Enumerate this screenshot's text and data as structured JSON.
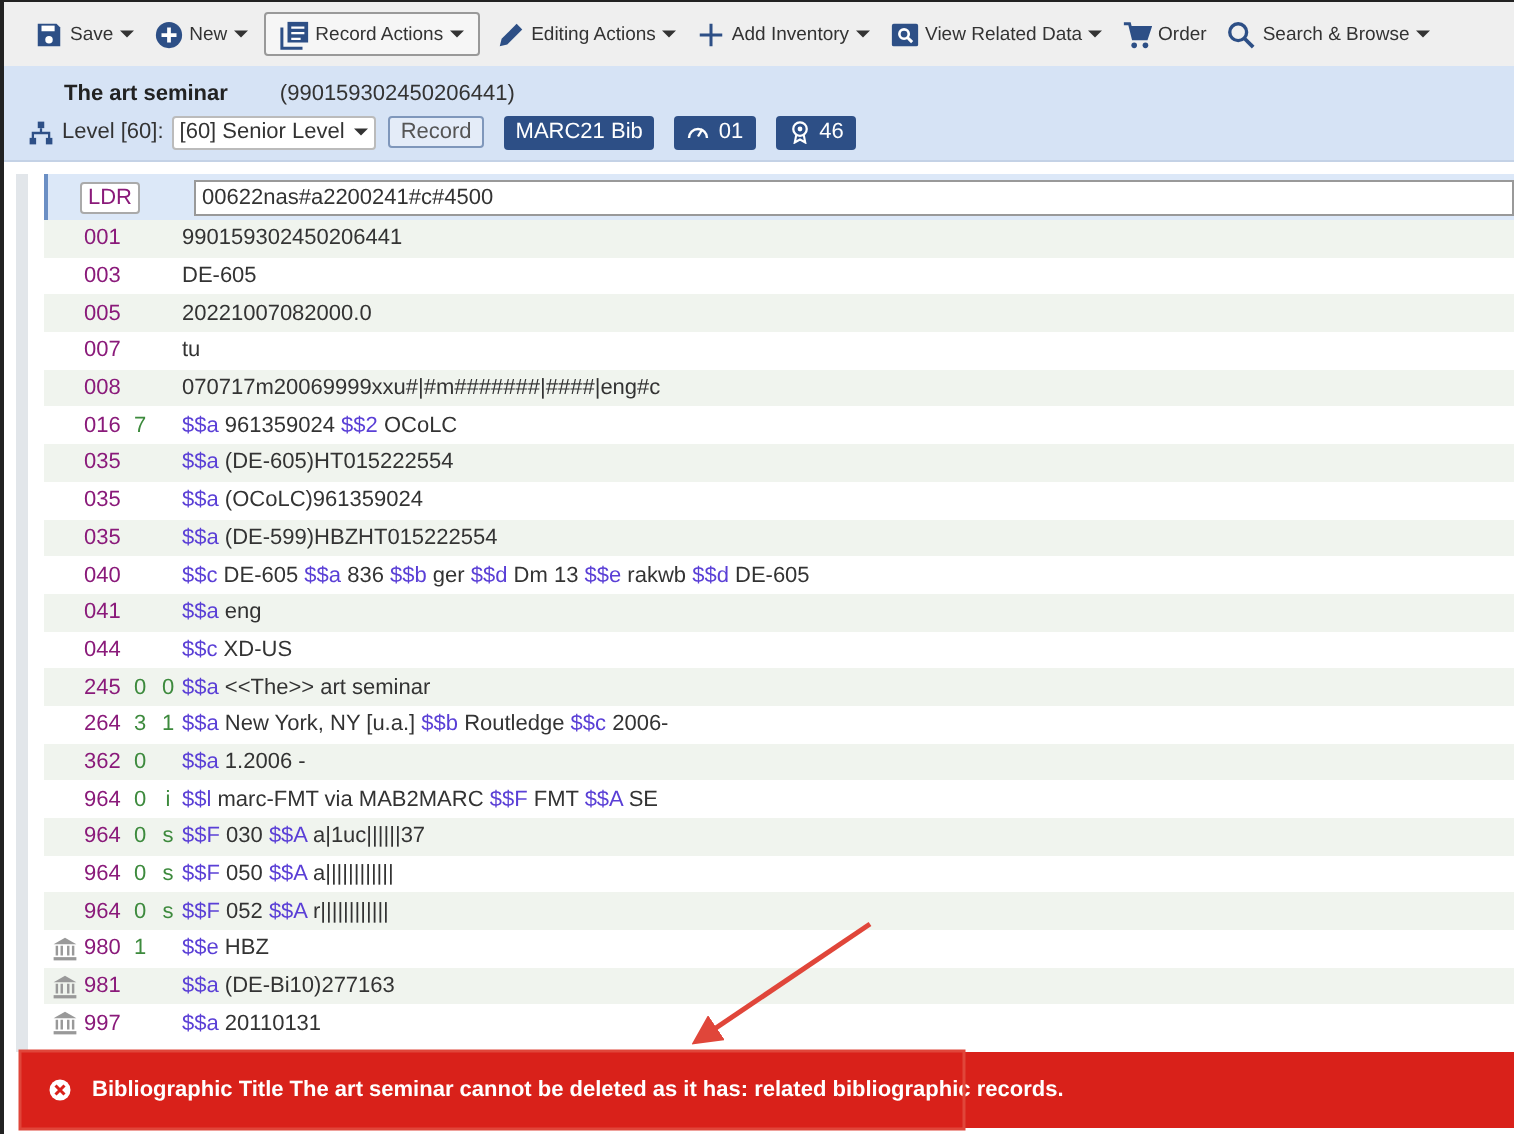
{
  "toolbar": [
    {
      "kind": "save",
      "label": "Save",
      "dropdown": true,
      "selected": false
    },
    {
      "kind": "new",
      "label": "New",
      "dropdown": true,
      "selected": false
    },
    {
      "kind": "record",
      "label": "Record Actions",
      "dropdown": true,
      "selected": true
    },
    {
      "kind": "edit",
      "label": "Editing Actions",
      "dropdown": true,
      "selected": false
    },
    {
      "kind": "add",
      "label": "Add Inventory",
      "dropdown": true,
      "selected": false
    },
    {
      "kind": "view",
      "label": "View Related Data",
      "dropdown": true,
      "selected": false
    },
    {
      "kind": "cart",
      "label": "Order",
      "dropdown": false,
      "selected": false
    },
    {
      "kind": "search",
      "label": "Search & Browse",
      "dropdown": true,
      "selected": false
    }
  ],
  "record_header": {
    "title": "The art seminar",
    "id": "(990159302450206441)",
    "level_label": "Level [60]:",
    "level_value": "[60] Senior Level",
    "record_button": "Record",
    "badges": [
      {
        "kind": "format",
        "label": "MARC21 Bib"
      },
      {
        "kind": "gauge",
        "label": "01"
      },
      {
        "kind": "award",
        "label": "46"
      }
    ]
  },
  "fields": [
    {
      "kind": "leader",
      "tag": "LDR",
      "value": "00622nas#a2200241#c#4500",
      "selected": true,
      "local": false
    },
    {
      "kind": "control",
      "tag": "001",
      "value": "990159302450206441",
      "selected": false,
      "local": false
    },
    {
      "kind": "control",
      "tag": "003",
      "value": "DE-605",
      "selected": false,
      "local": false
    },
    {
      "kind": "control",
      "tag": "005",
      "value": "20221007082000.0",
      "selected": false,
      "local": false
    },
    {
      "kind": "control",
      "tag": "007",
      "value": "tu",
      "selected": false,
      "local": false
    },
    {
      "kind": "control",
      "tag": "008",
      "value": "070717m20069999xxu#|#m#######|####|eng#c",
      "selected": false,
      "local": false
    },
    {
      "kind": "data",
      "tag": "016",
      "ind1": "7",
      "subfields": [
        {
          "code": "$$a",
          "value": "961359024"
        },
        {
          "code": "$$2",
          "value": "OCoLC"
        }
      ],
      "selected": false,
      "local": false
    },
    {
      "kind": "data",
      "tag": "035",
      "subfields": [
        {
          "code": "$$a",
          "value": "(DE-605)HT015222554"
        }
      ],
      "selected": false,
      "local": false
    },
    {
      "kind": "data",
      "tag": "035",
      "subfields": [
        {
          "code": "$$a",
          "value": "(OCoLC)961359024"
        }
      ],
      "selected": false,
      "local": false
    },
    {
      "kind": "data",
      "tag": "035",
      "subfields": [
        {
          "code": "$$a",
          "value": "(DE-599)HBZHT015222554"
        }
      ],
      "selected": false,
      "local": false
    },
    {
      "kind": "data",
      "tag": "040",
      "subfields": [
        {
          "code": "$$c",
          "value": "DE-605"
        },
        {
          "code": "$$a",
          "value": "836"
        },
        {
          "code": "$$b",
          "value": "ger"
        },
        {
          "code": "$$d",
          "value": "Dm 13"
        },
        {
          "code": "$$e",
          "value": "rakwb"
        },
        {
          "code": "$$d",
          "value": "DE-605"
        }
      ],
      "selected": false,
      "local": false
    },
    {
      "kind": "data",
      "tag": "041",
      "subfields": [
        {
          "code": "$$a",
          "value": "eng"
        }
      ],
      "selected": false,
      "local": false
    },
    {
      "kind": "data",
      "tag": "044",
      "subfields": [
        {
          "code": "$$c",
          "value": "XD-US"
        }
      ],
      "selected": false,
      "local": false
    },
    {
      "kind": "data",
      "tag": "245",
      "ind1": "0",
      "ind2": "0",
      "subfields": [
        {
          "code": "$$a",
          "value": "<<The>> art seminar"
        }
      ],
      "selected": false,
      "local": false
    },
    {
      "kind": "data",
      "tag": "264",
      "ind1": "3",
      "ind2": "1",
      "subfields": [
        {
          "code": "$$a",
          "value": "New York, NY [u.a.]"
        },
        {
          "code": "$$b",
          "value": "Routledge"
        },
        {
          "code": "$$c",
          "value": "2006-"
        }
      ],
      "selected": false,
      "local": false
    },
    {
      "kind": "data",
      "tag": "362",
      "ind1": "0",
      "subfields": [
        {
          "code": "$$a",
          "value": "1.2006 -"
        }
      ],
      "selected": false,
      "local": false
    },
    {
      "kind": "data",
      "tag": "964",
      "ind1": "0",
      "ind2": "i",
      "subfields": [
        {
          "code": "$$l",
          "value": "marc-FMT via MAB2MARC"
        },
        {
          "code": "$$F",
          "value": "FMT"
        },
        {
          "code": "$$A",
          "value": "SE"
        }
      ],
      "selected": false,
      "local": false
    },
    {
      "kind": "data",
      "tag": "964",
      "ind1": "0",
      "ind2": "s",
      "subfields": [
        {
          "code": "$$F",
          "value": "030"
        },
        {
          "code": "$$A",
          "value": "a|1uc||||||37"
        }
      ],
      "selected": false,
      "local": false
    },
    {
      "kind": "data",
      "tag": "964",
      "ind1": "0",
      "ind2": "s",
      "subfields": [
        {
          "code": "$$F",
          "value": "050"
        },
        {
          "code": "$$A",
          "value": "a||||||||||||"
        }
      ],
      "selected": false,
      "local": false
    },
    {
      "kind": "data",
      "tag": "964",
      "ind1": "0",
      "ind2": "s",
      "subfields": [
        {
          "code": "$$F",
          "value": "052"
        },
        {
          "code": "$$A",
          "value": "r||||||||||||"
        }
      ],
      "selected": false,
      "local": false
    },
    {
      "kind": "data",
      "tag": "980",
      "ind1": "1",
      "subfields": [
        {
          "code": "$$e",
          "value": "HBZ"
        }
      ],
      "selected": false,
      "local": true
    },
    {
      "kind": "data",
      "tag": "981",
      "subfields": [
        {
          "code": "$$a",
          "value": "(DE-Bi10)277163"
        }
      ],
      "selected": false,
      "local": true
    },
    {
      "kind": "data",
      "tag": "997",
      "subfields": [
        {
          "code": "$$a",
          "value": "20110131"
        }
      ],
      "selected": false,
      "local": true
    }
  ],
  "error_message": "Bibliographic Title The art seminar cannot be deleted as it has: related bibliographic records."
}
